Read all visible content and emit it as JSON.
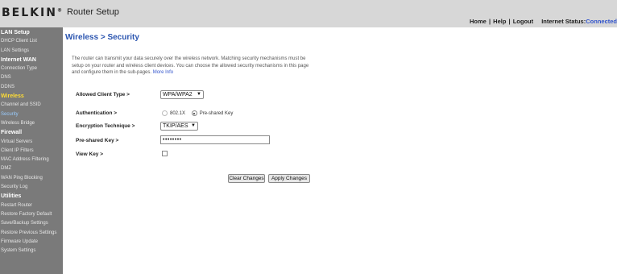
{
  "header": {
    "brand": "BELKIN",
    "brand_mark": "®",
    "title": "Router Setup",
    "links": {
      "home": "Home",
      "help": "Help",
      "logout": "Logout",
      "separator": "|"
    },
    "internet_status_label": "Internet Status:",
    "internet_status_value": "Connected"
  },
  "sidebar": {
    "sections": [
      {
        "heading": "LAN Setup",
        "items": [
          "DHCP Client List",
          "LAN Settings"
        ]
      },
      {
        "heading": "Internet WAN",
        "items": [
          "Connection Type",
          "DNS",
          "DDNS"
        ]
      },
      {
        "heading": "Wireless",
        "items": [
          "Channel and SSID",
          "Security",
          "Wireless Bridge"
        ]
      },
      {
        "heading": "Firewall",
        "items": [
          "Virtual Servers",
          "Client IP Filters",
          "MAC Address Filtering",
          "DMZ",
          "WAN Ping Blocking",
          "Security Log"
        ]
      },
      {
        "heading": "Utilities",
        "items": [
          "Restart Router",
          "Restore Factory Default",
          "Save/Backup Settings",
          "Restore Previous Settings",
          "Firmware Update",
          "System Settings"
        ]
      }
    ],
    "active_heading": "Wireless",
    "active_item": "Security"
  },
  "main": {
    "page_title": "Wireless > Security",
    "intro_text": "The router can transmit your data securely over the wireless network. Matching security mechanisms must be setup on your router and wireless client devices. You can choose the allowed security mechanisms in this page and configure them in the sub-pages.",
    "more_info": "More Info",
    "form": {
      "allowed_client_type_label": "Allowed Client Type >",
      "allowed_client_type_value": "WPA/WPA2",
      "authentication_label": "Authentication >",
      "auth_option_1": "802.1X",
      "auth_option_2": "Pre-shared Key",
      "encryption_label": "Encryption Technique >",
      "encryption_value": "TKIP/AES",
      "psk_label": "Pre-shared Key >",
      "psk_value": "••••••••",
      "view_key_label": "View Key >"
    },
    "buttons": {
      "clear": "Clear Changes",
      "apply": "Apply Changes"
    }
  },
  "icons": {
    "dropdown": "chevron-down-icon"
  },
  "colors": {
    "header_bg": "#d7d7d7",
    "sidebar_bg": "#7a7a7a",
    "title_blue": "#2b55b0",
    "active_heading": "#ffdd33",
    "active_item": "#99ccff"
  }
}
